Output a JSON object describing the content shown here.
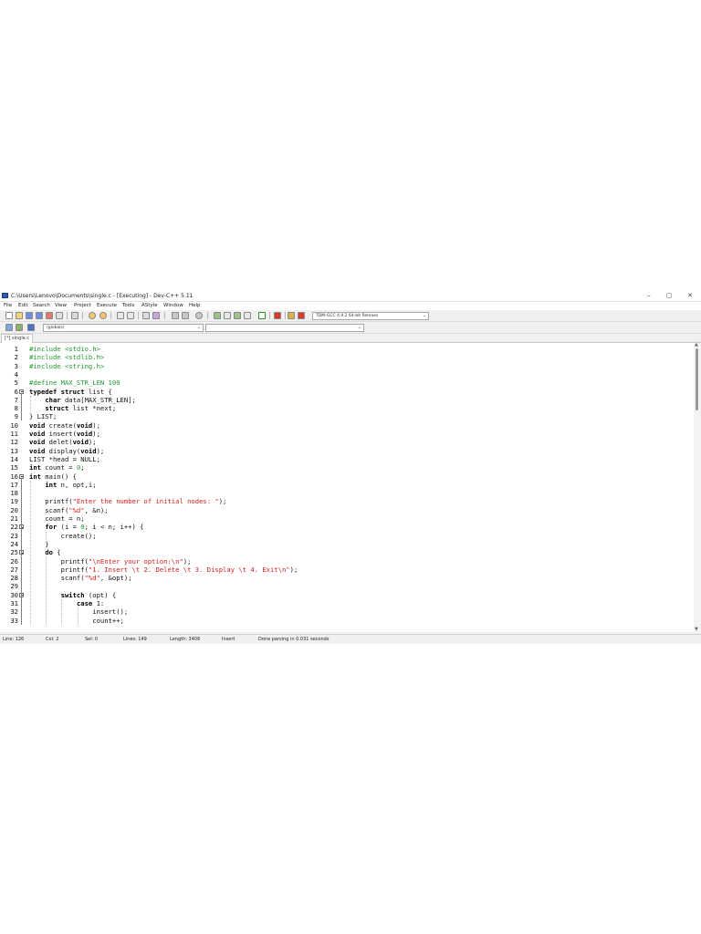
{
  "window": {
    "title": "C:\\Users\\Lenovo\\Documents\\single.c - [Executing] - Dev-C++ 5.11",
    "minimize": "–",
    "maximize": "▢",
    "close": "✕"
  },
  "menu": [
    "File",
    "Edit",
    "Search",
    "View",
    "Project",
    "Execute",
    "Tools",
    "AStyle",
    "Window",
    "Help"
  ],
  "toolbar": {
    "compiler_select": "TDM-GCC 4.9.2 64-bit Release",
    "scope_select": "(globals)",
    "function_select": ""
  },
  "tabs": [
    {
      "label": "[*] single.c",
      "active": true
    }
  ],
  "editor": {
    "lines": [
      {
        "n": "1",
        "tokens": [
          {
            "t": "#include <stdio.h>",
            "c": "pp"
          }
        ]
      },
      {
        "n": "2",
        "tokens": [
          {
            "t": "#include <stdlib.h>",
            "c": "pp"
          }
        ]
      },
      {
        "n": "3",
        "tokens": [
          {
            "t": "#include <string.h>",
            "c": "pp"
          }
        ]
      },
      {
        "n": "4",
        "tokens": []
      },
      {
        "n": "5",
        "tokens": [
          {
            "t": "#define MAX_STR_LEN 100",
            "c": "pp"
          }
        ]
      },
      {
        "n": "6",
        "tokens": [
          {
            "t": "typedef struct",
            "c": "kw"
          },
          {
            "t": " list {",
            "c": "plain"
          }
        ]
      },
      {
        "n": "7",
        "tokens": [
          {
            "t": "    ",
            "c": "plain"
          },
          {
            "t": "char",
            "c": "kw"
          },
          {
            "t": " data[MAX_STR_LEN];",
            "c": "plain"
          }
        ]
      },
      {
        "n": "8",
        "tokens": [
          {
            "t": "    ",
            "c": "plain"
          },
          {
            "t": "struct",
            "c": "kw"
          },
          {
            "t": " list *next;",
            "c": "plain"
          }
        ]
      },
      {
        "n": "9",
        "tokens": [
          {
            "t": "} LIST;",
            "c": "plain"
          }
        ]
      },
      {
        "n": "10",
        "tokens": [
          {
            "t": "void",
            "c": "kw"
          },
          {
            "t": " create(",
            "c": "plain"
          },
          {
            "t": "void",
            "c": "kw"
          },
          {
            "t": ");",
            "c": "plain"
          }
        ]
      },
      {
        "n": "11",
        "tokens": [
          {
            "t": "void",
            "c": "kw"
          },
          {
            "t": " insert(",
            "c": "plain"
          },
          {
            "t": "void",
            "c": "kw"
          },
          {
            "t": ");",
            "c": "plain"
          }
        ]
      },
      {
        "n": "12",
        "tokens": [
          {
            "t": "void",
            "c": "kw"
          },
          {
            "t": " delet(",
            "c": "plain"
          },
          {
            "t": "void",
            "c": "kw"
          },
          {
            "t": ");",
            "c": "plain"
          }
        ]
      },
      {
        "n": "13",
        "tokens": [
          {
            "t": "void",
            "c": "kw"
          },
          {
            "t": " display(",
            "c": "plain"
          },
          {
            "t": "void",
            "c": "kw"
          },
          {
            "t": ");",
            "c": "plain"
          }
        ]
      },
      {
        "n": "14",
        "tokens": [
          {
            "t": "LIST *head = NULL;",
            "c": "plain"
          }
        ]
      },
      {
        "n": "15",
        "tokens": [
          {
            "t": "int",
            "c": "kw"
          },
          {
            "t": " count = ",
            "c": "plain"
          },
          {
            "t": "0",
            "c": "num"
          },
          {
            "t": ";",
            "c": "plain"
          }
        ]
      },
      {
        "n": "16",
        "tokens": [
          {
            "t": "int",
            "c": "kw"
          },
          {
            "t": " main() {",
            "c": "plain"
          }
        ]
      },
      {
        "n": "17",
        "tokens": [
          {
            "t": "    ",
            "c": "plain"
          },
          {
            "t": "int",
            "c": "kw"
          },
          {
            "t": " n, opt,i;",
            "c": "plain"
          }
        ]
      },
      {
        "n": "18",
        "tokens": []
      },
      {
        "n": "19",
        "tokens": [
          {
            "t": "    printf(",
            "c": "plain"
          },
          {
            "t": "\"Enter the number of initial nodes: \"",
            "c": "str"
          },
          {
            "t": ");",
            "c": "plain"
          }
        ]
      },
      {
        "n": "20",
        "tokens": [
          {
            "t": "    scanf(",
            "c": "plain"
          },
          {
            "t": "\"%d\"",
            "c": "str"
          },
          {
            "t": ", &n);",
            "c": "plain"
          }
        ]
      },
      {
        "n": "21",
        "tokens": [
          {
            "t": "    count = n;",
            "c": "plain"
          }
        ]
      },
      {
        "n": "22",
        "tokens": [
          {
            "t": "    ",
            "c": "plain"
          },
          {
            "t": "for",
            "c": "kw"
          },
          {
            "t": " (i = ",
            "c": "plain"
          },
          {
            "t": "0",
            "c": "num"
          },
          {
            "t": "; i < n; i++) {",
            "c": "plain"
          }
        ]
      },
      {
        "n": "23",
        "tokens": [
          {
            "t": "        create();",
            "c": "plain"
          }
        ]
      },
      {
        "n": "24",
        "tokens": [
          {
            "t": "    }",
            "c": "plain"
          }
        ]
      },
      {
        "n": "25",
        "tokens": [
          {
            "t": "    ",
            "c": "plain"
          },
          {
            "t": "do",
            "c": "kw"
          },
          {
            "t": " {",
            "c": "plain"
          }
        ]
      },
      {
        "n": "26",
        "tokens": [
          {
            "t": "        printf(",
            "c": "plain"
          },
          {
            "t": "\"\\nEnter your option:\\n\"",
            "c": "str"
          },
          {
            "t": ");",
            "c": "plain"
          }
        ]
      },
      {
        "n": "27",
        "tokens": [
          {
            "t": "        printf(",
            "c": "plain"
          },
          {
            "t": "\"1. Insert \\t 2. Delete \\t 3. Display \\t 4. Exit\\n\"",
            "c": "str"
          },
          {
            "t": ");",
            "c": "plain"
          }
        ]
      },
      {
        "n": "28",
        "tokens": [
          {
            "t": "        scanf(",
            "c": "plain"
          },
          {
            "t": "\"%d\"",
            "c": "str"
          },
          {
            "t": ", &opt);",
            "c": "plain"
          }
        ]
      },
      {
        "n": "29",
        "tokens": []
      },
      {
        "n": "30",
        "tokens": [
          {
            "t": "        ",
            "c": "plain"
          },
          {
            "t": "switch",
            "c": "kw"
          },
          {
            "t": " (opt) {",
            "c": "plain"
          }
        ]
      },
      {
        "n": "31",
        "tokens": [
          {
            "t": "            ",
            "c": "plain"
          },
          {
            "t": "case",
            "c": "kw"
          },
          {
            "t": " 1:",
            "c": "plain"
          }
        ]
      },
      {
        "n": "32",
        "tokens": [
          {
            "t": "                insert();",
            "c": "plain"
          }
        ]
      },
      {
        "n": "33",
        "tokens": [
          {
            "t": "                count++;",
            "c": "plain"
          }
        ]
      }
    ]
  },
  "statusbar": {
    "line": "Line:   126",
    "col": "Col:   2",
    "sel": "Sel:   0",
    "lines": "Lines:   149",
    "length": "Length:   3406",
    "mode": "Insert",
    "message": "Done parsing in 0.031 seconds"
  },
  "colors": {
    "preprocessor": "#1f9a2f",
    "keyword": "#000000",
    "string": "#d81b1b",
    "number": "#1f9a2f"
  }
}
